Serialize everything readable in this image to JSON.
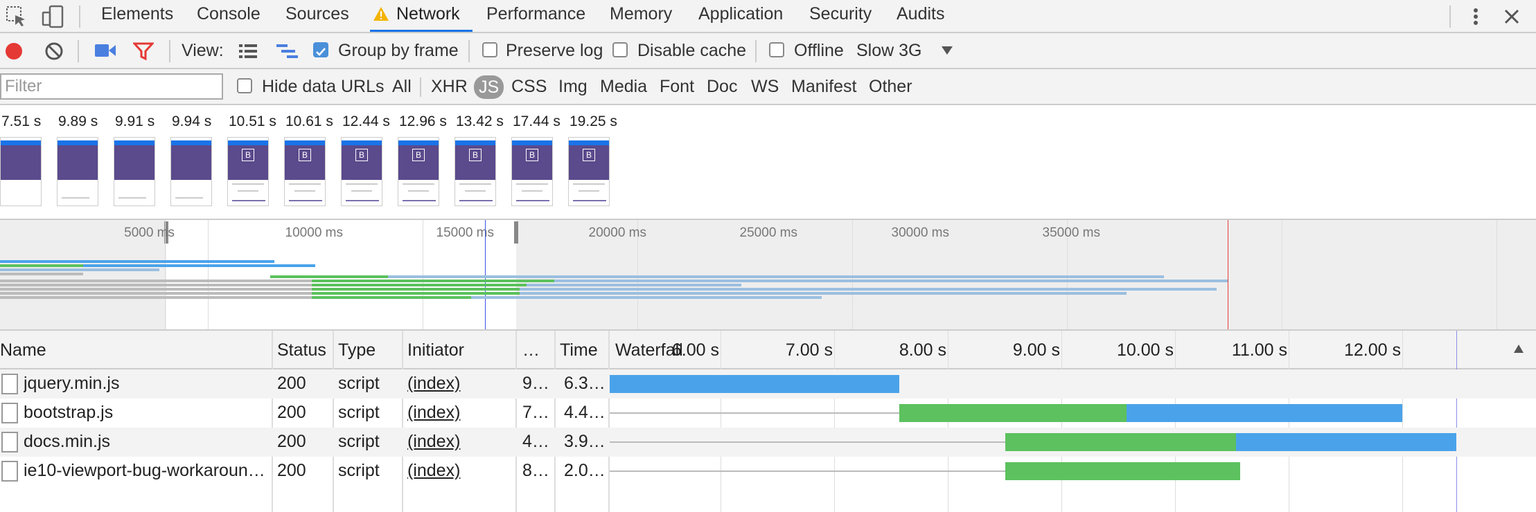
{
  "tabs": [
    "Elements",
    "Console",
    "Sources",
    "Network",
    "Performance",
    "Memory",
    "Application",
    "Security",
    "Audits"
  ],
  "active_tab": "Network",
  "toolbar": {
    "view_label": "View:",
    "group_by_frame": "Group by frame",
    "preserve_log": "Preserve log",
    "disable_cache": "Disable cache",
    "offline": "Offline",
    "throttle": "Slow 3G"
  },
  "filter": {
    "placeholder": "Filter",
    "hide_data_urls": "Hide data URLs",
    "types": [
      "All",
      "XHR",
      "JS",
      "CSS",
      "Img",
      "Media",
      "Font",
      "Doc",
      "WS",
      "Manifest",
      "Other"
    ],
    "selected_type": "JS"
  },
  "filmstrip": [
    "7.51 s",
    "9.89 s",
    "9.91 s",
    "9.94 s",
    "10.51 s",
    "10.61 s",
    "12.44 s",
    "12.96 s",
    "13.42 s",
    "17.44 s",
    "19.25 s"
  ],
  "overview": {
    "labels": [
      "5000 ms",
      "10000 ms",
      "15000 ms",
      "20000 ms",
      "25000 ms",
      "30000 ms",
      "35000 ms"
    ]
  },
  "grid": {
    "headers": {
      "name": "Name",
      "status": "Status",
      "type": "Type",
      "initiator": "Initiator",
      "size": "…",
      "time": "Time",
      "waterfall": "Waterfall"
    },
    "waterfall_ticks": [
      "6.00 s",
      "7.00 s",
      "8.00 s",
      "9.00 s",
      "10.00 s",
      "11.00 s",
      "12.00 s"
    ],
    "rows": [
      {
        "name": "jquery.min.js",
        "status": "200",
        "type": "script",
        "initiator": "(index)",
        "size": "9…",
        "time": "6.3…"
      },
      {
        "name": "bootstrap.js",
        "status": "200",
        "type": "script",
        "initiator": "(index)",
        "size": "7…",
        "time": "4.4…"
      },
      {
        "name": "docs.min.js",
        "status": "200",
        "type": "script",
        "initiator": "(index)",
        "size": "4…",
        "time": "3.9…"
      },
      {
        "name": "ie10-viewport-bug-workaroun…",
        "status": "200",
        "type": "script",
        "initiator": "(index)",
        "size": "8…",
        "time": "2.0…"
      }
    ]
  },
  "colors": {
    "waiting": "#5cc15e",
    "download": "#4aa3ea",
    "record": "#e53935",
    "filter_icon": "#e53935",
    "capture_icon": "#4a7fe0"
  }
}
